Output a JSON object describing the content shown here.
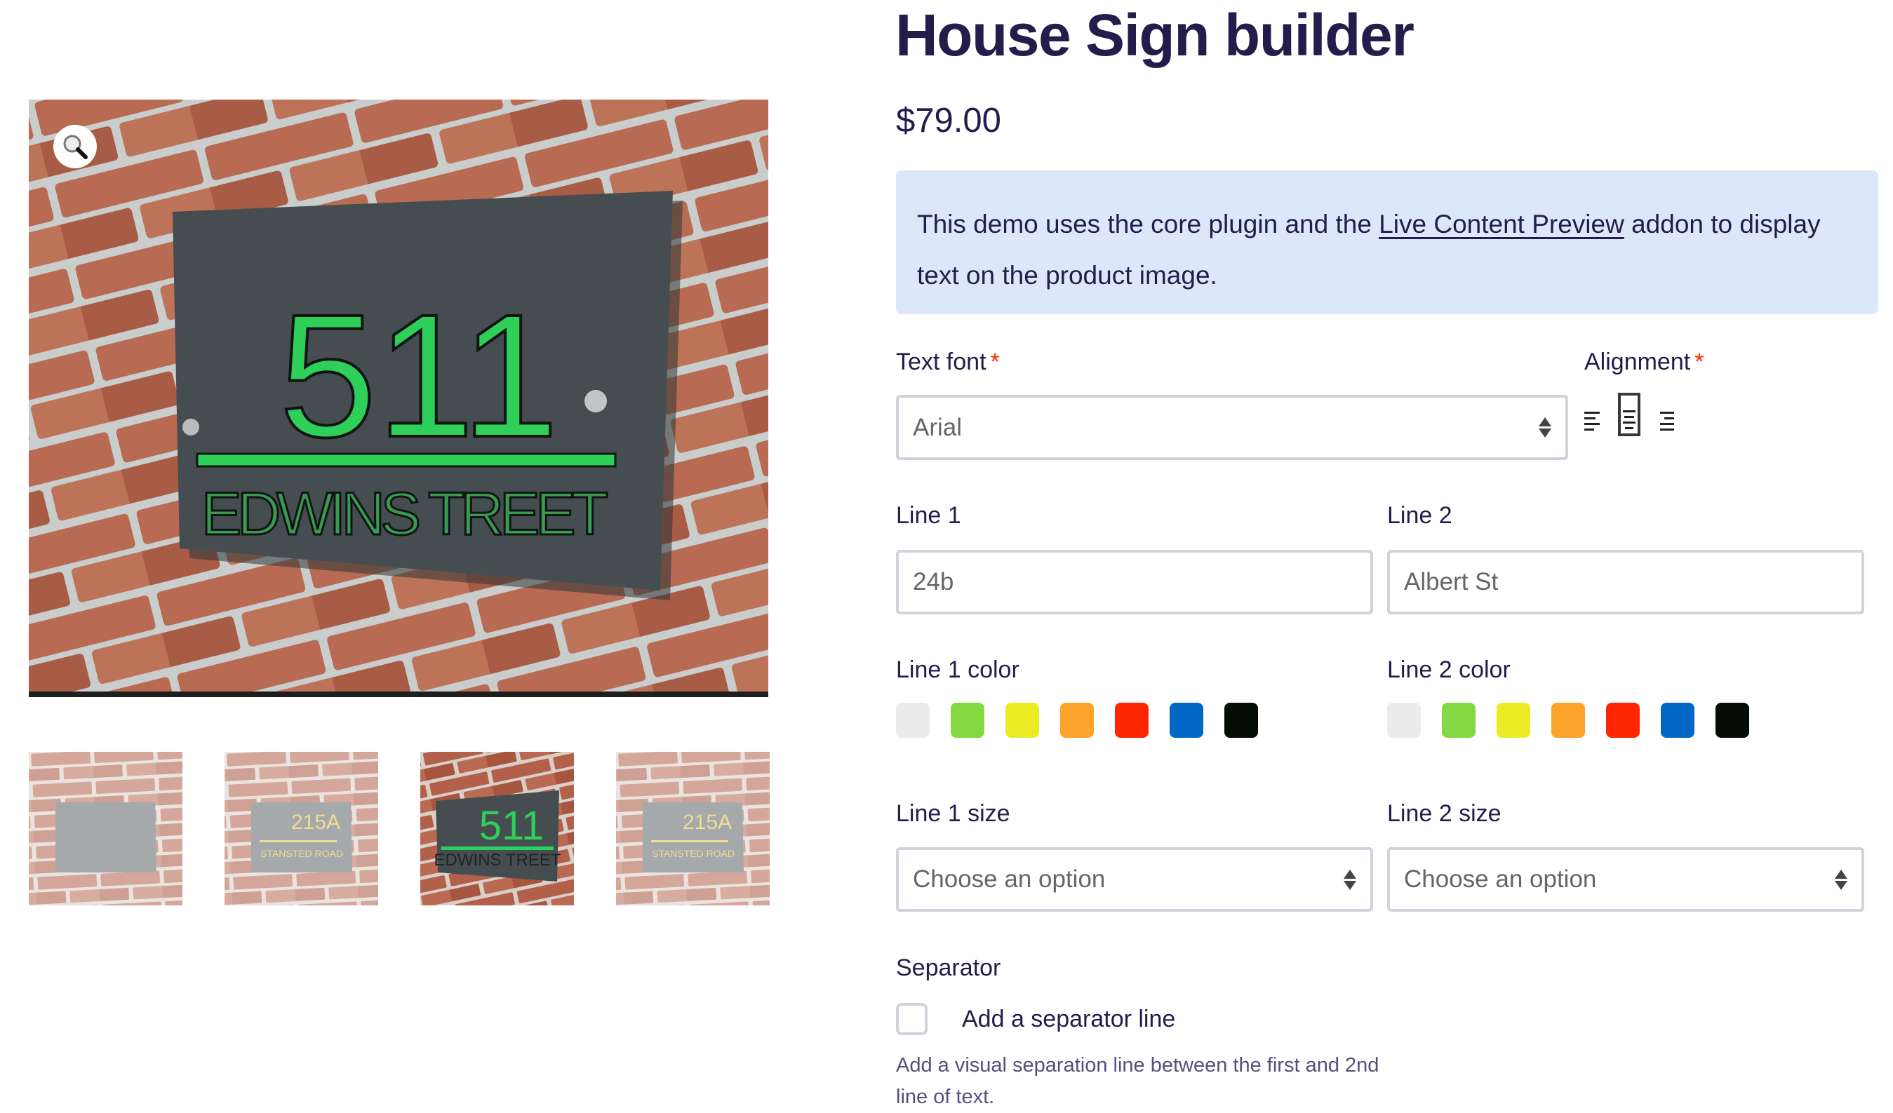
{
  "product": {
    "title": "House Sign builder",
    "price": "$79.00"
  },
  "notice": {
    "text_before": "This demo uses the core plugin and the ",
    "link_text": "Live Content Preview",
    "text_after": " addon to display text on the product image."
  },
  "gallery": {
    "main_image": {
      "sign_number": "511",
      "sign_street": "EDWINS TREET",
      "text_color": "#2fd05a"
    },
    "zoom_icon": "magnifier-icon",
    "thumbnails": [
      {
        "label": "blank-sign",
        "number": "",
        "street": "",
        "active": false
      },
      {
        "label": "215a-sign",
        "number": "215A",
        "street": "STANSTED ROAD",
        "active": false
      },
      {
        "label": "511-sign",
        "number": "511",
        "street": "EDWINS TREET",
        "active": true
      },
      {
        "label": "215a-angled-sign",
        "number": "215A",
        "street": "STANSTED ROAD",
        "active": false
      }
    ]
  },
  "form": {
    "text_font": {
      "label": "Text font",
      "required": "*",
      "value": "Arial"
    },
    "alignment": {
      "label": "Alignment",
      "required": "*",
      "options": [
        "left",
        "center",
        "right"
      ],
      "selected": "center"
    },
    "line1": {
      "label": "Line 1",
      "value": "24b"
    },
    "line2": {
      "label": "Line 2",
      "value": "Albert St"
    },
    "line1_color": {
      "label": "Line 1 color"
    },
    "line2_color": {
      "label": "Line 2 color"
    },
    "colors": [
      "#ececec",
      "#84d943",
      "#ebec26",
      "#fda22a",
      "#ff2500",
      "#0067c5",
      "#040c05"
    ],
    "line1_size": {
      "label": "Line 1 size",
      "value": "Choose an option"
    },
    "line2_size": {
      "label": "Line 2 size",
      "value": "Choose an option"
    },
    "separator": {
      "label": "Separator",
      "checkbox_label": "Add a separator line",
      "checked": false,
      "description": "Add a visual separation line between the first and 2nd line of text."
    }
  }
}
